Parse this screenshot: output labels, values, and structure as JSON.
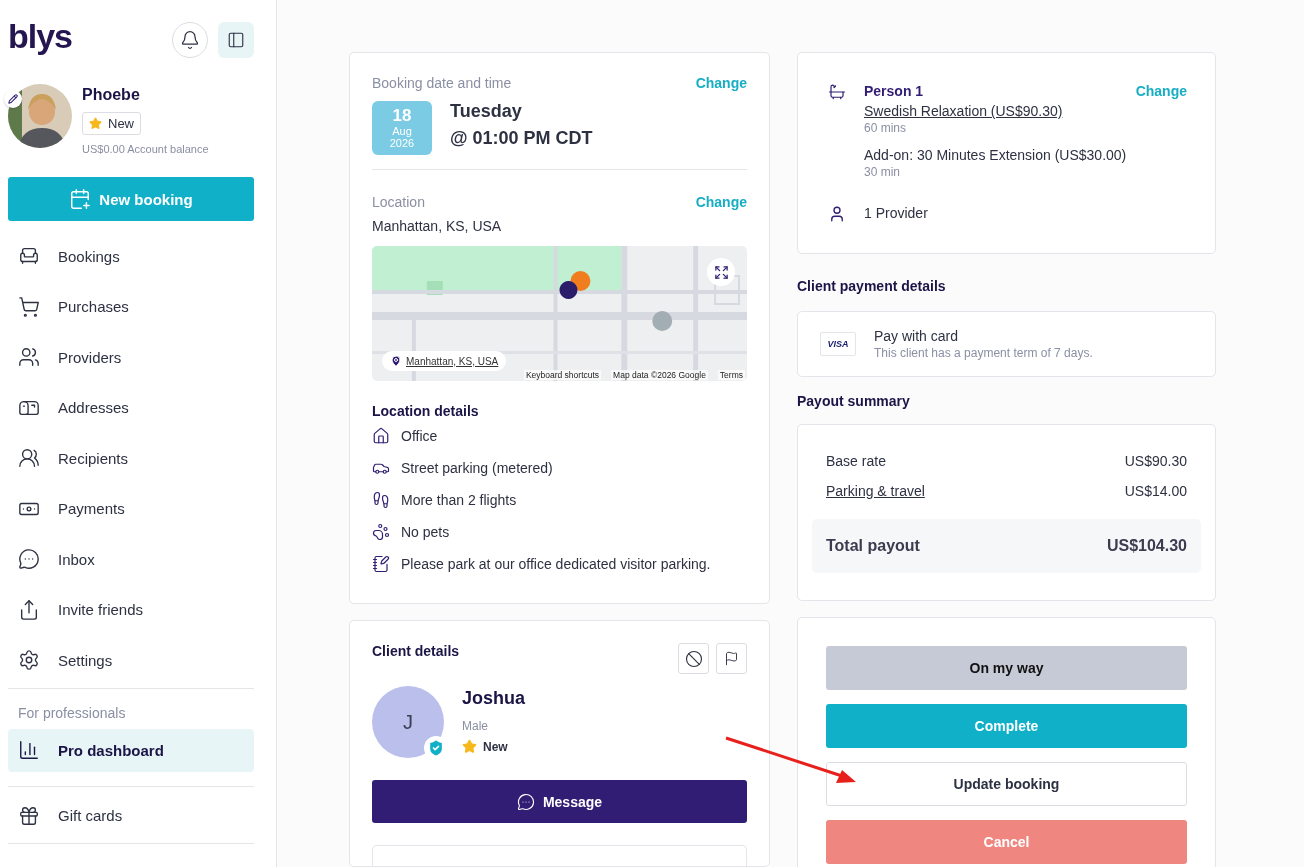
{
  "sidebar": {
    "logo": "blys",
    "profile": {
      "name": "Phoebe",
      "badge": "New",
      "balance": "US$0.00 Account balance"
    },
    "new_booking": "New booking",
    "nav_items": [
      {
        "kind": "bookings",
        "label": "Bookings",
        "selected": false
      },
      {
        "kind": "purchases",
        "label": "Purchases",
        "selected": false
      },
      {
        "kind": "providers",
        "label": "Providers",
        "selected": false
      },
      {
        "kind": "addresses",
        "label": "Addresses",
        "selected": false
      },
      {
        "kind": "recipients",
        "label": "Recipients",
        "selected": false
      },
      {
        "kind": "payments",
        "label": "Payments",
        "selected": false
      },
      {
        "kind": "inbox",
        "label": "Inbox",
        "selected": false
      },
      {
        "kind": "invite",
        "label": "Invite friends",
        "selected": false
      },
      {
        "kind": "settings",
        "label": "Settings",
        "selected": false
      }
    ],
    "section_label": "For professionals",
    "pro_items": [
      {
        "kind": "dashboard",
        "label": "Pro dashboard",
        "selected": true
      }
    ],
    "bottom_items": [
      {
        "kind": "gift",
        "label": "Gift cards",
        "selected": false
      }
    ]
  },
  "booking": {
    "label": "Booking date and time",
    "change": "Change",
    "day": "18",
    "month": "Aug",
    "year": "2026",
    "weekday": "Tuesday",
    "time": "@ 01:00 PM CDT"
  },
  "location": {
    "label": "Location",
    "change": "Change",
    "address": "Manhattan, KS, USA",
    "map": {
      "chip": "Manhattan, KS, USA",
      "attributions": [
        "Keyboard shortcuts",
        "Map data ©2026 Google",
        "Terms"
      ]
    }
  },
  "location_details": {
    "title": "Location details",
    "items": [
      {
        "kind": "house",
        "text": "Office"
      },
      {
        "kind": "car",
        "text": "Street parking (metered)"
      },
      {
        "kind": "stairs",
        "text": "More than 2 flights"
      },
      {
        "kind": "paw",
        "text": "No pets"
      },
      {
        "kind": "note",
        "text": "Please park at our office dedicated visitor parking."
      }
    ]
  },
  "client": {
    "title": "Client details",
    "initial": "J",
    "name": "Joshua",
    "gender": "Male",
    "badge": "New",
    "message": "Message"
  },
  "service": {
    "person": "Person 1",
    "change": "Change",
    "treatment": "Swedish Relaxation (US$90.30)",
    "duration": "60 mins",
    "addon": "Add-on: 30 Minutes Extension (US$30.00)",
    "addon_duration": "30 min",
    "providers": "1 Provider"
  },
  "payment": {
    "title": "Client payment details",
    "card_brand": "VISA",
    "method": "Pay with card",
    "note": "This client has a payment term of 7 days."
  },
  "payout": {
    "title": "Payout summary",
    "rows": [
      {
        "label": "Base rate",
        "value": "US$90.30",
        "link": false
      },
      {
        "label": "Parking & travel",
        "value": "US$14.00",
        "link": true
      }
    ],
    "total": {
      "label": "Total payout",
      "value": "US$104.30"
    }
  },
  "actions": [
    {
      "kind": "muted",
      "label": "On my way"
    },
    {
      "kind": "primary",
      "label": "Complete"
    },
    {
      "kind": "outline",
      "label": "Update booking"
    },
    {
      "kind": "danger",
      "label": "Cancel"
    }
  ]
}
